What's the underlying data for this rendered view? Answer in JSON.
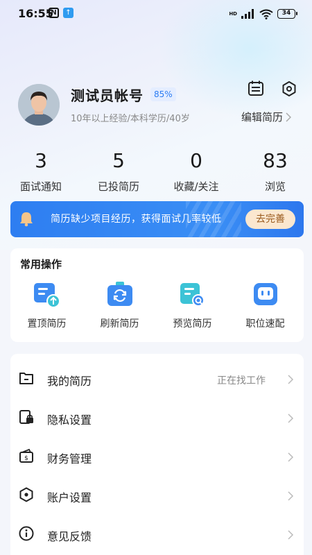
{
  "status_bar": {
    "time": "16:55",
    "notif_n": "N",
    "notif_arrow": "↑",
    "network": "HD",
    "battery": "34"
  },
  "profile": {
    "name": "测试员帐号",
    "completeness": "85%",
    "meta": "10年以上经验/本科学历/40岁",
    "edit_label": "编辑简历"
  },
  "stats": [
    {
      "value": "3",
      "label": "面试通知"
    },
    {
      "value": "5",
      "label": "已投简历"
    },
    {
      "value": "0",
      "label": "收藏/关注"
    },
    {
      "value": "83",
      "label": "浏览"
    }
  ],
  "banner": {
    "text": "简历缺少项目经历，获得面试几率较低",
    "button": "去完善"
  },
  "quick_actions": {
    "title": "常用操作",
    "items": [
      {
        "label": "置顶简历",
        "icon": "pin-resume-icon"
      },
      {
        "label": "刷新简历",
        "icon": "refresh-resume-icon"
      },
      {
        "label": "预览简历",
        "icon": "preview-resume-icon"
      },
      {
        "label": "职位速配",
        "icon": "job-match-icon"
      }
    ]
  },
  "menu": [
    {
      "label": "我的简历",
      "value": "正在找工作",
      "icon": "folder-icon"
    },
    {
      "label": "隐私设置",
      "icon": "privacy-lock-icon"
    },
    {
      "label": "财务管理",
      "icon": "wallet-icon"
    },
    {
      "label": "账户设置",
      "icon": "hexagon-settings-icon"
    },
    {
      "label": "意见反馈",
      "icon": "info-icon"
    }
  ],
  "colors": {
    "accent": "#2e7ef1",
    "banner_button_bg": "#fbe7cf",
    "banner_button_text": "#9a5b1e",
    "icon_blue": "#3d8bf2",
    "icon_teal": "#3cc3d6"
  }
}
